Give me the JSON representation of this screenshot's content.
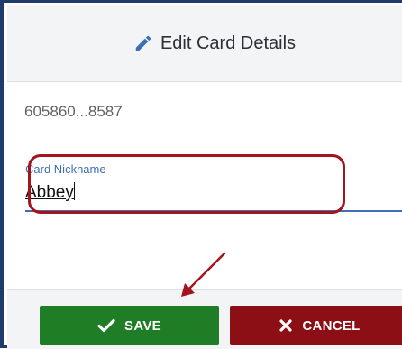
{
  "dialog": {
    "title": "Edit Card Details",
    "card_number": "605860...8587"
  },
  "nickname_field": {
    "label": "Card Nickname",
    "value": "Abbey"
  },
  "buttons": {
    "save_label": "SAVE",
    "cancel_label": "CANCEL"
  },
  "icons": {
    "title_icon": "pencil-icon",
    "save_icon": "checkmark-icon",
    "cancel_icon": "x-icon"
  },
  "colors": {
    "save": "#1e7d25",
    "cancel": "#8b0f14",
    "annotation": "#a3141d",
    "field_accent": "#3d6fb5"
  }
}
